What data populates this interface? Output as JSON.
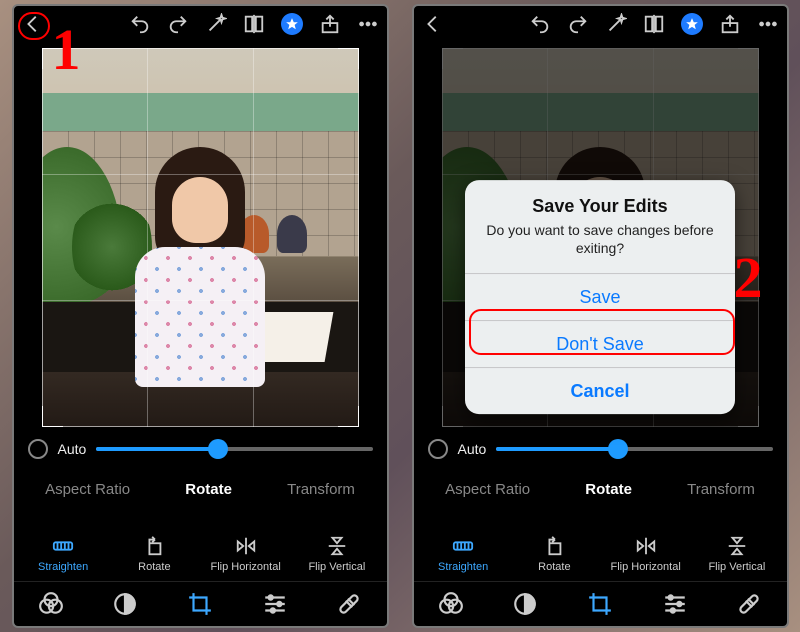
{
  "annotations": {
    "step1": "1",
    "step2": "2"
  },
  "topbar": {},
  "slider": {
    "label": "Auto"
  },
  "tabs": {
    "aspect": "Aspect Ratio",
    "rotate": "Rotate",
    "transform": "Transform"
  },
  "tools": {
    "straighten": "Straighten",
    "rotate": "Rotate",
    "flipH": "Flip Horizontal",
    "flipV": "Flip Vertical"
  },
  "dialog": {
    "title": "Save Your Edits",
    "message": "Do you want to save changes before exiting?",
    "save": "Save",
    "dontsave": "Don't Save",
    "cancel": "Cancel"
  }
}
